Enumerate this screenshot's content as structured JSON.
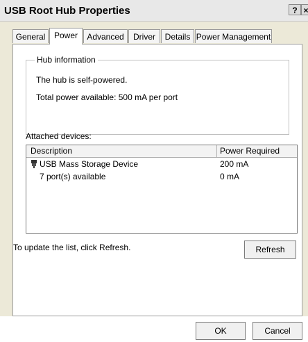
{
  "window": {
    "title": "USB Root Hub Properties",
    "help_button": "?",
    "close_button": "×"
  },
  "tabs": [
    {
      "label": "General"
    },
    {
      "label": "Power"
    },
    {
      "label": "Advanced"
    },
    {
      "label": "Driver"
    },
    {
      "label": "Details"
    },
    {
      "label": "Power Management"
    }
  ],
  "hub_info": {
    "title": "Hub information",
    "self_powered": "The hub is self-powered.",
    "total_power": "Total power available:  500 mA per port"
  },
  "attached": {
    "label": "Attached devices:",
    "columns": [
      "Description",
      "Power Required"
    ],
    "rows": [
      {
        "description": "USB Mass Storage Device",
        "power": "200 mA",
        "icon": "usb-plug-icon"
      },
      {
        "description": "7 port(s) available",
        "power": "0 mA"
      }
    ]
  },
  "refresh": {
    "hint": "To update the list, click Refresh.",
    "button": "Refresh"
  },
  "buttons": {
    "ok": "OK",
    "cancel": "Cancel"
  }
}
